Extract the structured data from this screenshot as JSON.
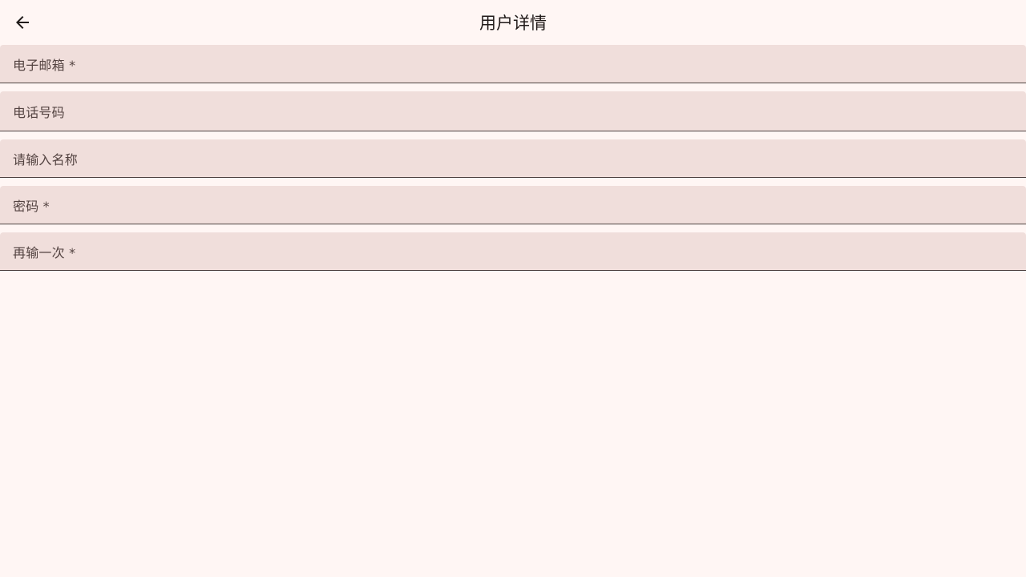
{
  "header": {
    "title": "用户详情",
    "back_icon": "arrow-back-icon"
  },
  "form": {
    "fields": [
      {
        "label": "电子邮箱 *"
      },
      {
        "label": "电话号码"
      },
      {
        "label": "请输入名称"
      },
      {
        "label": "密码 *"
      },
      {
        "label": "再输一次 *"
      }
    ]
  },
  "colors": {
    "background": "#fff6f4",
    "field_fill": "#f0dedb",
    "field_underline": "#4f4443",
    "label_text": "#534341",
    "title_text": "#201a19"
  }
}
